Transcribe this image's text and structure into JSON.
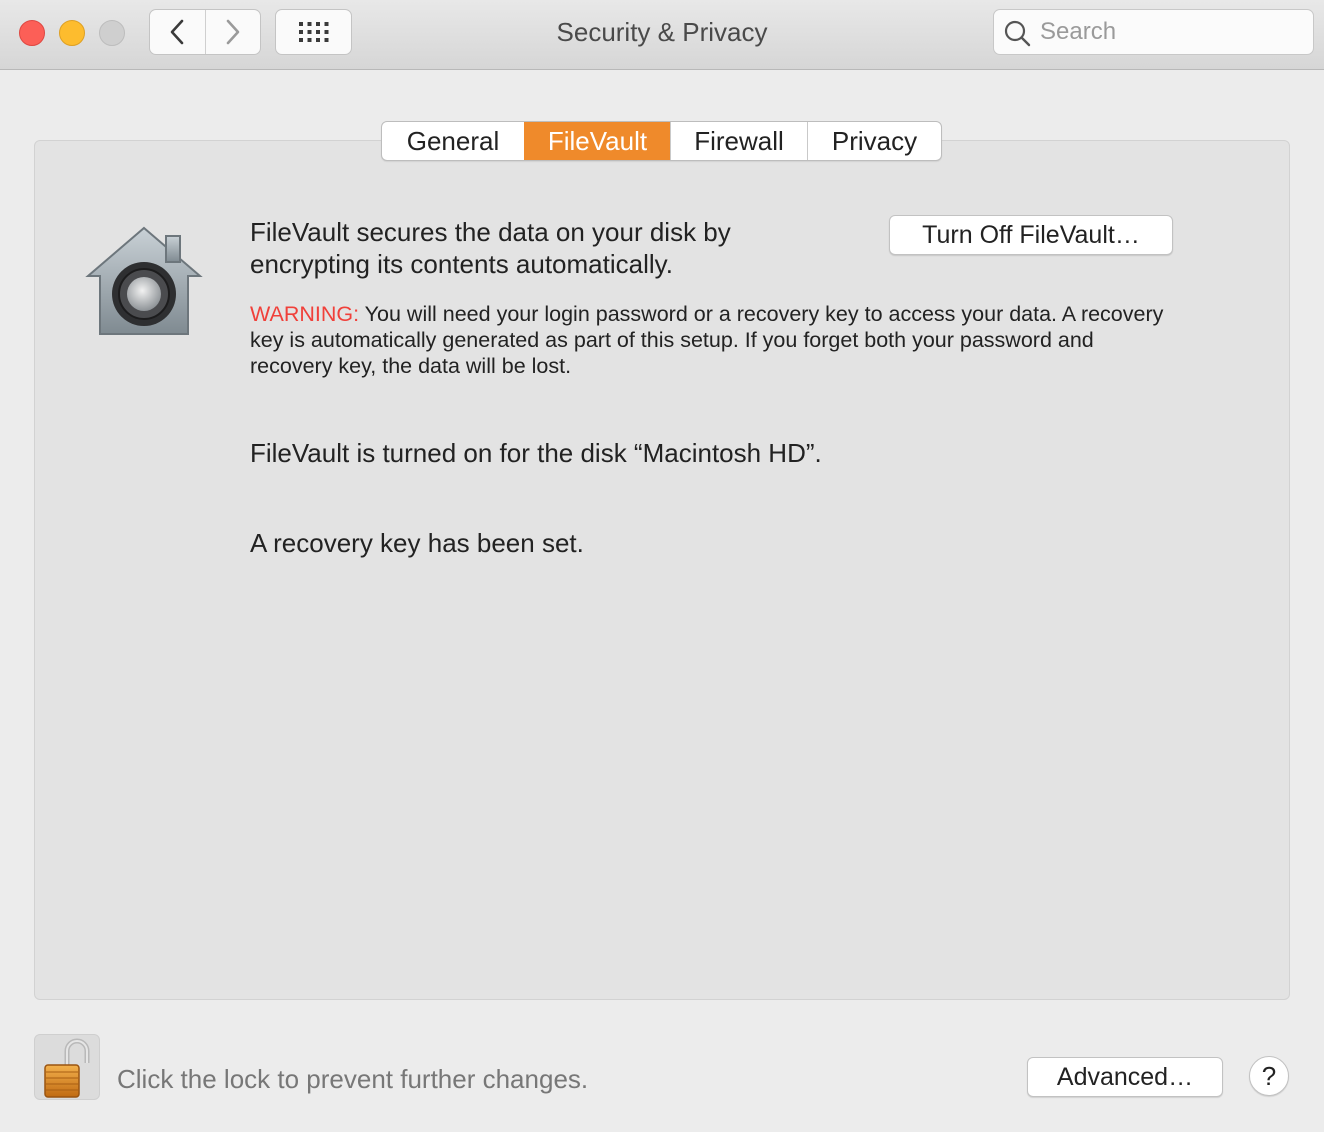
{
  "window": {
    "title": "Security & Privacy"
  },
  "toolbar": {
    "back_icon": "chevron-left-icon",
    "forward_icon": "chevron-right-icon",
    "show_all_icon": "grid-icon"
  },
  "search": {
    "placeholder": "Search",
    "value": ""
  },
  "tabs": [
    {
      "label": "General",
      "active": false
    },
    {
      "label": "FileVault",
      "active": true
    },
    {
      "label": "Firewall",
      "active": false
    },
    {
      "label": "Privacy",
      "active": false
    }
  ],
  "filevault": {
    "description": "FileVault secures the data on your disk by encrypting its contents automatically.",
    "turn_off_label": "Turn Off FileVault…",
    "warning_label": "WARNING:",
    "warning_text": " You will need your login password or a recovery key to access your data. A recovery key is automatically generated as part of this setup. If you forget both your password and recovery key, the data will be lost.",
    "status_disk": "FileVault is turned on for the disk “Macintosh HD”.",
    "status_recovery": "A recovery key has been set."
  },
  "footer": {
    "lock_text": "Click the lock to prevent further changes.",
    "advanced_label": "Advanced…",
    "help_label": "?"
  },
  "colors": {
    "accent": "#ef8a2b",
    "warning": "#f0403a",
    "close": "#fc5f57",
    "minimize": "#fdbc2e",
    "maximize": "#cfcfcf"
  }
}
